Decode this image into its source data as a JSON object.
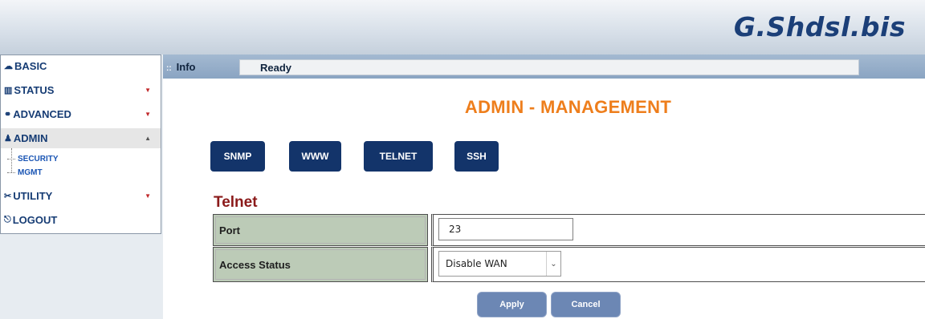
{
  "header": {
    "brand": "G.Shdsl.bis"
  },
  "sidebar": {
    "items": [
      {
        "label": "BASIC",
        "icon": "cloud-icon"
      },
      {
        "label": "STATUS",
        "icon": "chart-icon"
      },
      {
        "label": "ADVANCED",
        "icon": "link-icon"
      },
      {
        "label": "ADMIN",
        "icon": "users-icon"
      },
      {
        "label": "UTILITY",
        "icon": "tools-icon"
      },
      {
        "label": "LOGOUT",
        "icon": "logout-icon"
      }
    ],
    "admin_submenu": [
      {
        "label": "SECURITY"
      },
      {
        "label": "MGMT"
      }
    ]
  },
  "infobar": {
    "label": "Info",
    "status": "Ready"
  },
  "main": {
    "title": "ADMIN - MANAGEMENT",
    "tabs": [
      {
        "label": "SNMP"
      },
      {
        "label": "WWW"
      },
      {
        "label": "TELNET"
      },
      {
        "label": "SSH"
      }
    ],
    "section_title": "Telnet",
    "form": {
      "port": {
        "label": "Port",
        "value": "23"
      },
      "access_status": {
        "label": "Access Status",
        "selected": "Disable WAN"
      }
    },
    "buttons": {
      "apply": "Apply",
      "cancel": "Cancel"
    }
  },
  "colors": {
    "brand": "#1b3f78",
    "menu_text": "#163c74",
    "title_orange": "#ee7e1c",
    "section_red": "#8b1a1a",
    "tab_navy": "#13346a",
    "label_cell": "#bccbb7",
    "action_button": "#6c87b4"
  }
}
